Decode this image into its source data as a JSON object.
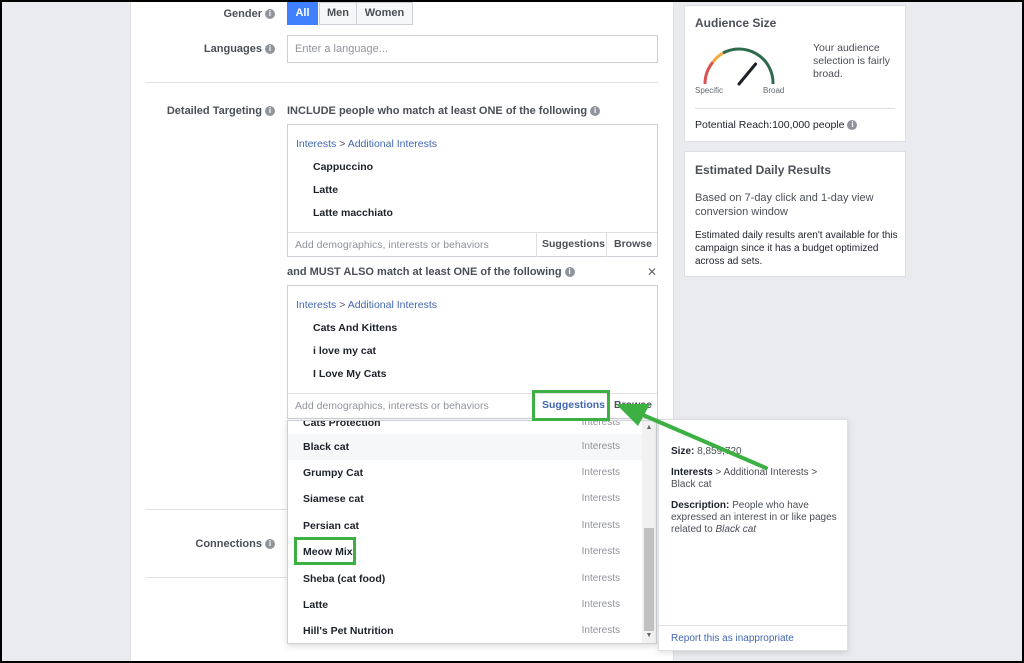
{
  "gender": {
    "label": "Gender",
    "options": [
      "All",
      "Men",
      "Women"
    ],
    "selected": "All"
  },
  "languages": {
    "label": "Languages",
    "placeholder": "Enter a language..."
  },
  "detailed_targeting": {
    "label": "Detailed Targeting",
    "include_heading": "INCLUDE people who match at least ONE of the following",
    "include_box": {
      "breadcrumb": {
        "category": "Interests",
        "separator": ">",
        "subcategory": "Additional Interests"
      },
      "items": [
        "Cappuccino",
        "Latte",
        "Latte macchiato"
      ],
      "add_placeholder": "Add demographics, interests or behaviors",
      "suggestions_label": "Suggestions",
      "browse_label": "Browse"
    },
    "must_heading": "and MUST ALSO match at least ONE of the following",
    "close_symbol": "✕",
    "must_box": {
      "breadcrumb": {
        "category": "Interests",
        "separator": ">",
        "subcategory": "Additional Interests"
      },
      "items": [
        "Cats And Kittens",
        "i love my cat",
        "I Love My Cats"
      ],
      "add_placeholder": "Add demographics, interests or behaviors",
      "suggestions_label": "Suggestions",
      "browse_label": "Browse"
    }
  },
  "connections": {
    "label": "Connections"
  },
  "suggestions_dropdown": {
    "partial_top": {
      "name": "Cats Protection",
      "type": "Interests"
    },
    "rows": [
      {
        "name": "Black cat",
        "type": "Interests"
      },
      {
        "name": "Grumpy Cat",
        "type": "Interests"
      },
      {
        "name": "Siamese cat",
        "type": "Interests"
      },
      {
        "name": "Persian cat",
        "type": "Interests"
      },
      {
        "name": "Meow Mix",
        "type": "Interests"
      },
      {
        "name": "Sheba (cat food)",
        "type": "Interests"
      },
      {
        "name": "Latte",
        "type": "Interests"
      },
      {
        "name": "Hill's Pet Nutrition",
        "type": "Interests"
      }
    ],
    "hovered_row": "Black cat",
    "highlighted_row": "Meow Mix"
  },
  "detail_panel": {
    "size_label": "Size:",
    "size_value": "8,859,720",
    "path_category": "Interests",
    "path_separator": ">",
    "path_rest": "Additional Interests >",
    "path_leaf": "Black cat",
    "description_label": "Description:",
    "description_text": "People who have expressed an interest in or like pages related to",
    "description_subject": "Black cat",
    "report_link": "Report this as inappropriate"
  },
  "audience_size": {
    "title": "Audience Size",
    "gauge_left": "Specific",
    "gauge_right": "Broad",
    "gauge_level": 0.72,
    "summary": "Your audience selection is fairly broad.",
    "reach_label": "Potential Reach:",
    "reach_value": "100,000 people"
  },
  "estimated_results": {
    "title": "Estimated Daily Results",
    "basis": "Based on 7-day click and 1-day view conversion window",
    "note": "Estimated daily results aren't available for this campaign since it has a budget optimized across ad sets."
  },
  "colors": {
    "accent_blue": "#4080ff",
    "link_blue": "#4267b2",
    "highlight_green": "#3cb043",
    "gauge_dark_green": "#2e6b4b",
    "gauge_orange": "#f2a93b",
    "gauge_red": "#d9534f"
  }
}
